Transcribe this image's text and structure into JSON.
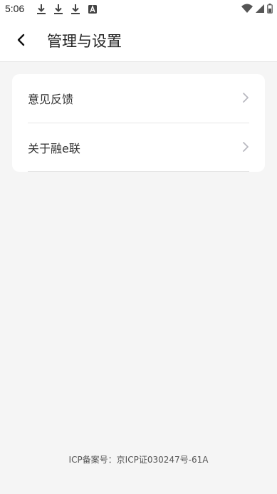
{
  "status_bar": {
    "time": "5:06",
    "left_icons": [
      "download-icon",
      "download-icon",
      "download-icon",
      "font-a-icon"
    ],
    "right_icons": [
      "wifi-icon",
      "cell-signal-icon",
      "battery-icon"
    ]
  },
  "header": {
    "title": "管理与设置",
    "back_icon": "chevron-left-icon"
  },
  "menu": {
    "items": [
      {
        "label": "意见反馈",
        "icon": "chevron-right-icon"
      },
      {
        "label": "关于融e联",
        "icon": "chevron-right-icon"
      }
    ]
  },
  "footer": {
    "icp": "ICP备案号：京ICP证030247号-61A"
  },
  "colors": {
    "background": "#f5f5f5",
    "surface": "#ffffff",
    "text_primary": "#222222",
    "chevron": "#b8b8c0"
  }
}
